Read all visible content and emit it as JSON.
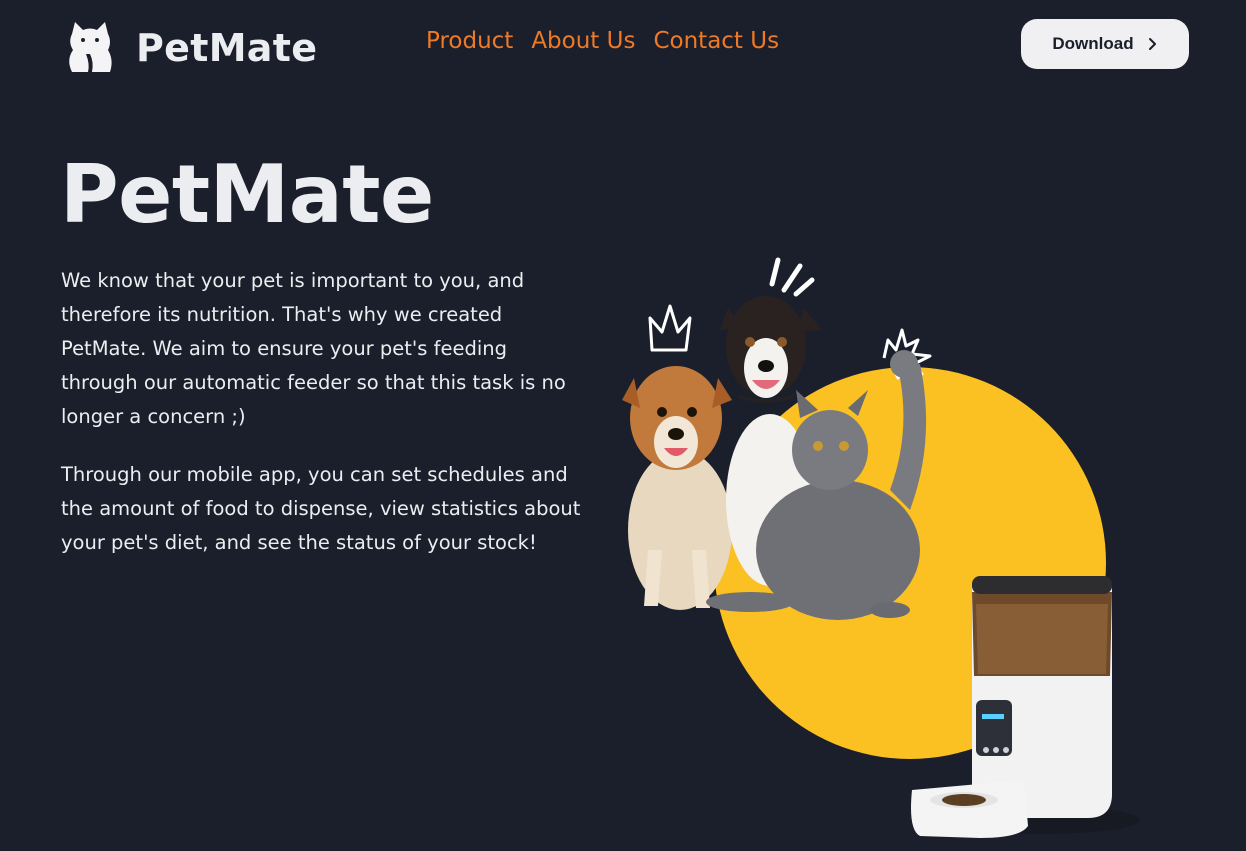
{
  "header": {
    "brand": "PetMate",
    "nav": [
      {
        "label": "Product"
      },
      {
        "label": "About Us"
      },
      {
        "label": "Contact Us"
      }
    ],
    "download_label": "Download"
  },
  "hero": {
    "title": "PetMate",
    "paragraphs": [
      "We know that your pet is important to you, and therefore its nutrition. That's why we created PetMate. We aim to ensure your pet's feeding through our automatic feeder so that this task is no longer a concern ;)",
      "Through our mobile app, you can set schedules and the amount of food to dispense, view statistics about your pet's diet, and see the status of your stock!"
    ]
  },
  "colors": {
    "background": "#1b1f2b",
    "accent": "#ef7a25",
    "circle": "#fbc021",
    "button_bg": "#f0f0f2"
  },
  "icons": [
    "cat-logo-icon",
    "chevron-right-icon",
    "crown-doodle-icon",
    "sparkle-doodle-icon",
    "burst-doodle-icon"
  ]
}
